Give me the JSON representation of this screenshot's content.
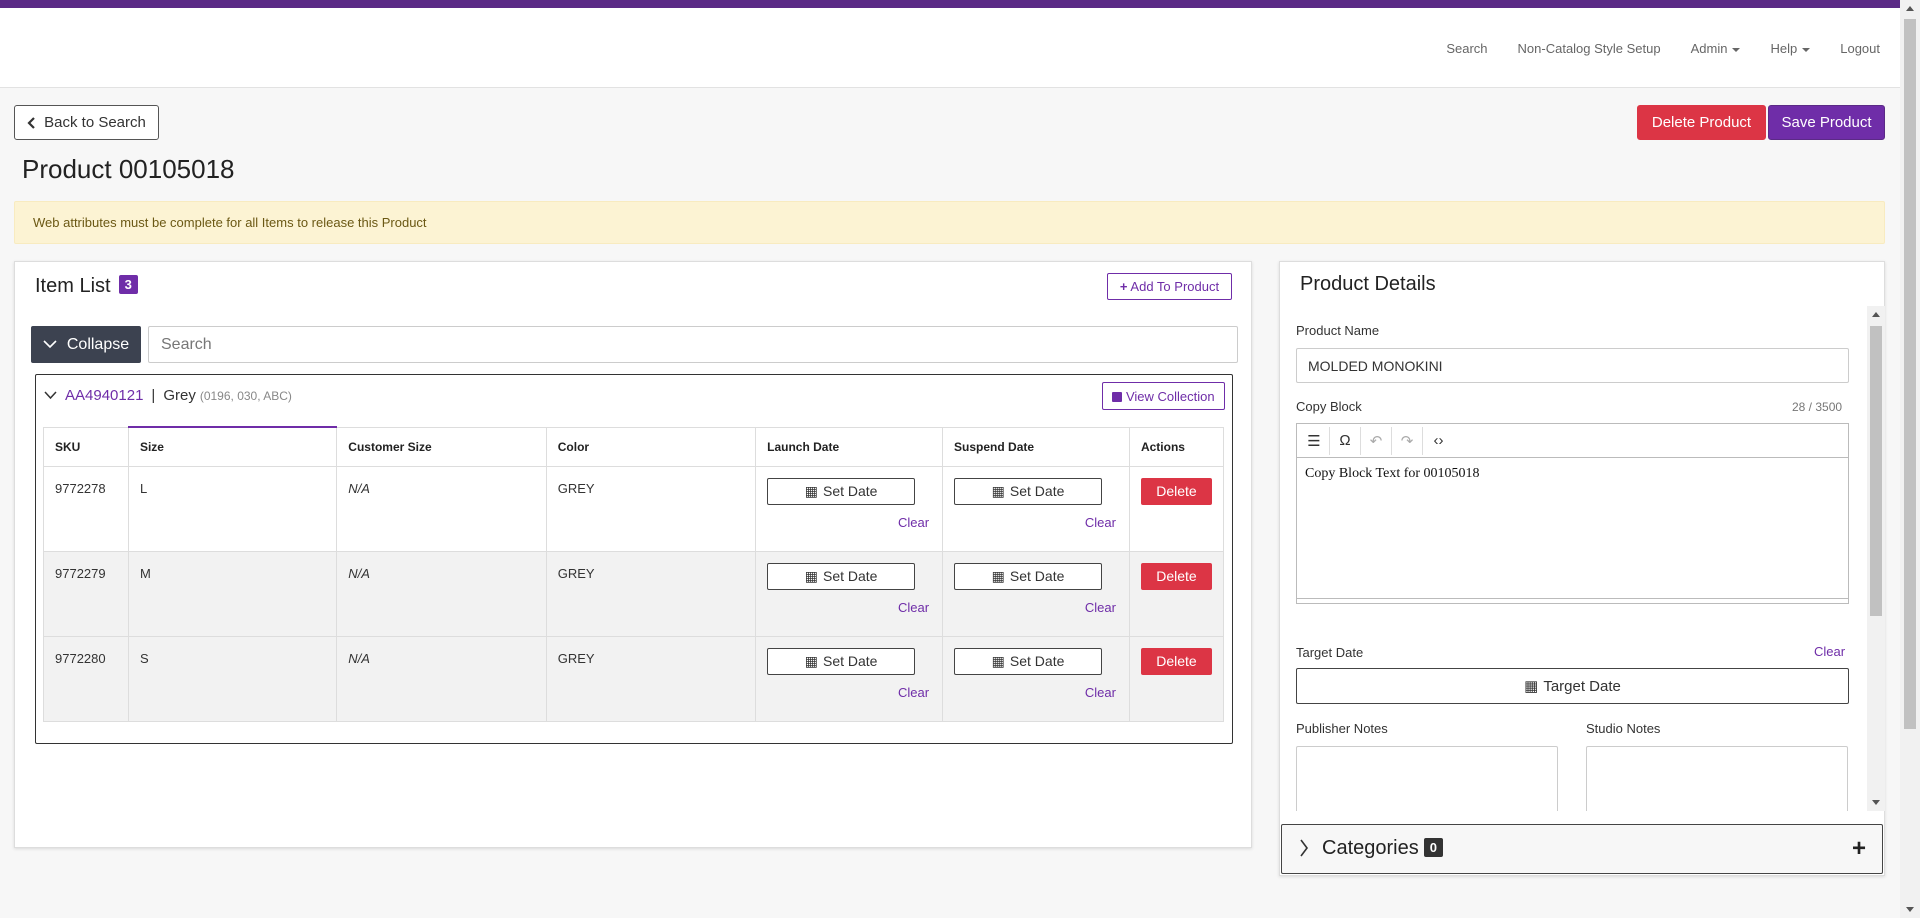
{
  "nav": {
    "links": [
      "Search",
      "Non-Catalog Style Setup",
      "Admin",
      "Help",
      "Logout"
    ],
    "accent_color": "#5b2a86"
  },
  "header": {
    "back_label": "Back to Search",
    "delete_label": "Delete Product",
    "save_label": "Save Product",
    "title": "Product 00105018"
  },
  "alert": {
    "text": "Web attributes must be complete for all Items to release this Product"
  },
  "item_list": {
    "title": "Item List",
    "count": "3",
    "add_label": "Add To Product",
    "collapse_label": "Collapse",
    "search_placeholder": "Search",
    "collection": {
      "code": "AA4940121",
      "separator": "|",
      "name": "Grey",
      "codes": "(0196, 030, ABC)",
      "view_label": "View Collection"
    },
    "columns": [
      "SKU",
      "Size",
      "Customer Size",
      "Color",
      "Launch Date",
      "Suspend Date",
      "Actions"
    ],
    "rows": [
      {
        "sku": "9772278",
        "size": "L",
        "customer_size": "N/A",
        "color": "GREY"
      },
      {
        "sku": "9772279",
        "size": "M",
        "customer_size": "N/A",
        "color": "GREY"
      },
      {
        "sku": "9772280",
        "size": "S",
        "customer_size": "N/A",
        "color": "GREY"
      }
    ],
    "set_date_label": "Set Date",
    "clear_label": "Clear",
    "delete_label": "Delete"
  },
  "product_details": {
    "title": "Product Details",
    "product_name_label": "Product Name",
    "product_name_value": "MOLDED MONOKINI",
    "copy_block_label": "Copy Block",
    "copy_block_count": "28 / 3500",
    "copy_block_text": "Copy Block Text for 00105018",
    "target_date_label": "Target Date",
    "target_clear": "Clear",
    "target_button": "Target Date",
    "publisher_notes_label": "Publisher Notes",
    "studio_notes_label": "Studio Notes"
  },
  "categories": {
    "label": "Categories",
    "count": "0"
  }
}
